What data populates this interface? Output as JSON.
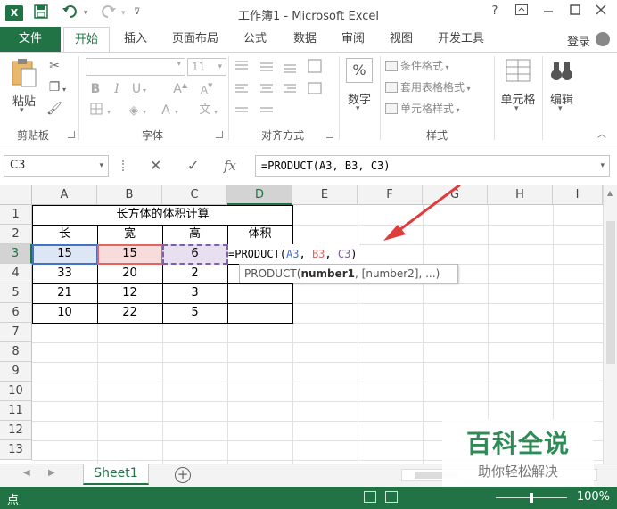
{
  "titlebar": {
    "app_logo": "X",
    "title": "工作簿1 - Microsoft Excel",
    "help": "?",
    "icons": [
      "save-icon",
      "undo-icon",
      "redo-icon",
      "customize-qat-icon",
      "ribbon-display-icon",
      "minimize-icon",
      "maximize-icon",
      "close-icon"
    ]
  },
  "tabs": {
    "file": "文件",
    "items": [
      "开始",
      "插入",
      "页面布局",
      "公式",
      "数据",
      "审阅",
      "视图",
      "开发工具"
    ],
    "active": "开始",
    "login": "登录"
  },
  "ribbon": {
    "clipboard": {
      "paste": "粘贴",
      "label": "剪贴板"
    },
    "font": {
      "size": "11",
      "bold": "B",
      "italic": "I",
      "underline": "U",
      "grow": "A",
      "shrink": "A",
      "font_color": "A",
      "phonetic": "文",
      "label": "字体"
    },
    "alignment": {
      "label": "对齐方式"
    },
    "number": {
      "icon": "%",
      "button": "数字"
    },
    "styles": {
      "conditional": "条件格式",
      "table": "套用表格格式",
      "cell": "单元格样式",
      "label": "样式"
    },
    "cells": {
      "button": "单元格"
    },
    "editing": {
      "button": "编辑"
    }
  },
  "formula_bar": {
    "name_box": "C3",
    "cancel": "✕",
    "enter": "✓",
    "fx": "fx",
    "formula": "=PRODUCT(A3, B3, C3)"
  },
  "grid": {
    "columns": [
      "A",
      "B",
      "C",
      "D",
      "E",
      "F",
      "G",
      "H",
      "I"
    ],
    "rows": [
      "1",
      "2",
      "3",
      "4",
      "5",
      "6",
      "7",
      "8",
      "9",
      "10",
      "11",
      "12",
      "13"
    ],
    "selected_column": "D",
    "selected_row": "3",
    "title": "长方体的体积计算",
    "headers": [
      "长",
      "宽",
      "高",
      "体积"
    ],
    "data": [
      [
        "15",
        "15",
        "6"
      ],
      [
        "33",
        "20",
        "2"
      ],
      [
        "21",
        "12",
        "3"
      ],
      [
        "10",
        "22",
        "5"
      ]
    ],
    "edit_cell": {
      "prefix": "=PRODUCT(",
      "ref1": "A3",
      "sep1": ", ",
      "ref2": "B3",
      "sep2": ", ",
      "ref3": "C3",
      "suffix": ")"
    },
    "tooltip": {
      "func": "PRODUCT(",
      "arg1": "number1",
      "rest": ", [number2], ...)"
    },
    "ref_colors": {
      "a3": "#4472c4",
      "b3": "#e06666",
      "c3": "#7f5fa8"
    },
    "annotation_color": "#e03b3b"
  },
  "sheets": {
    "active": "Sheet1",
    "add": "+"
  },
  "watermark": {
    "title": "百科全说",
    "subtitle": "助你轻松解决"
  },
  "status": {
    "mode": "点",
    "zoom": "100%"
  },
  "colors": {
    "accent": "#217346"
  }
}
